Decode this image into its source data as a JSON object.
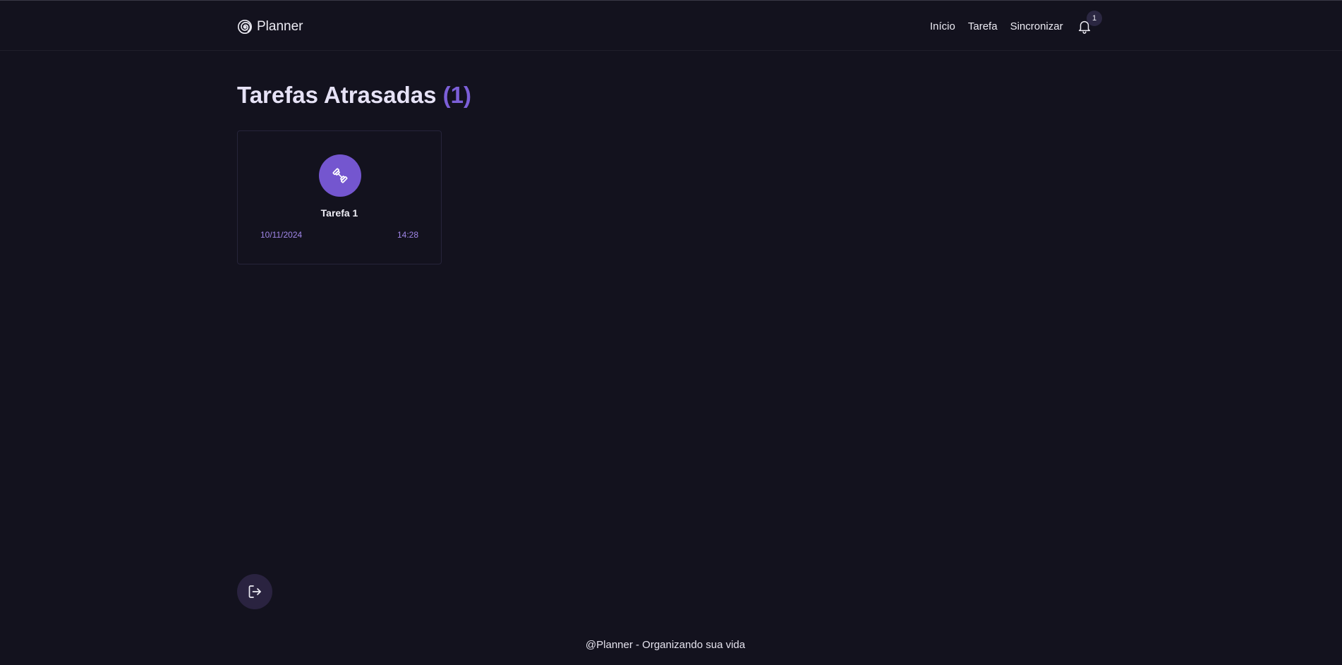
{
  "header": {
    "brand_name": "Planner",
    "brand_icon": "spiral-logo-icon",
    "nav": [
      {
        "label": "Início"
      },
      {
        "label": "Tarefa"
      },
      {
        "label": "Sincronizar"
      }
    ],
    "notifications": {
      "icon": "bell-icon",
      "count": "1"
    }
  },
  "main": {
    "title": "Tarefas Atrasadas",
    "title_count": "(1)",
    "tasks": [
      {
        "icon": "dumbbell-icon",
        "title": "Tarefa 1",
        "date": "10/11/2024",
        "time": "14:28"
      }
    ]
  },
  "logout": {
    "icon": "logout-icon"
  },
  "footer": {
    "text": "@Planner - Organizando sua vida"
  },
  "colors": {
    "background": "#13121e",
    "accent": "#7456cf",
    "accent_text": "#a086e8"
  }
}
